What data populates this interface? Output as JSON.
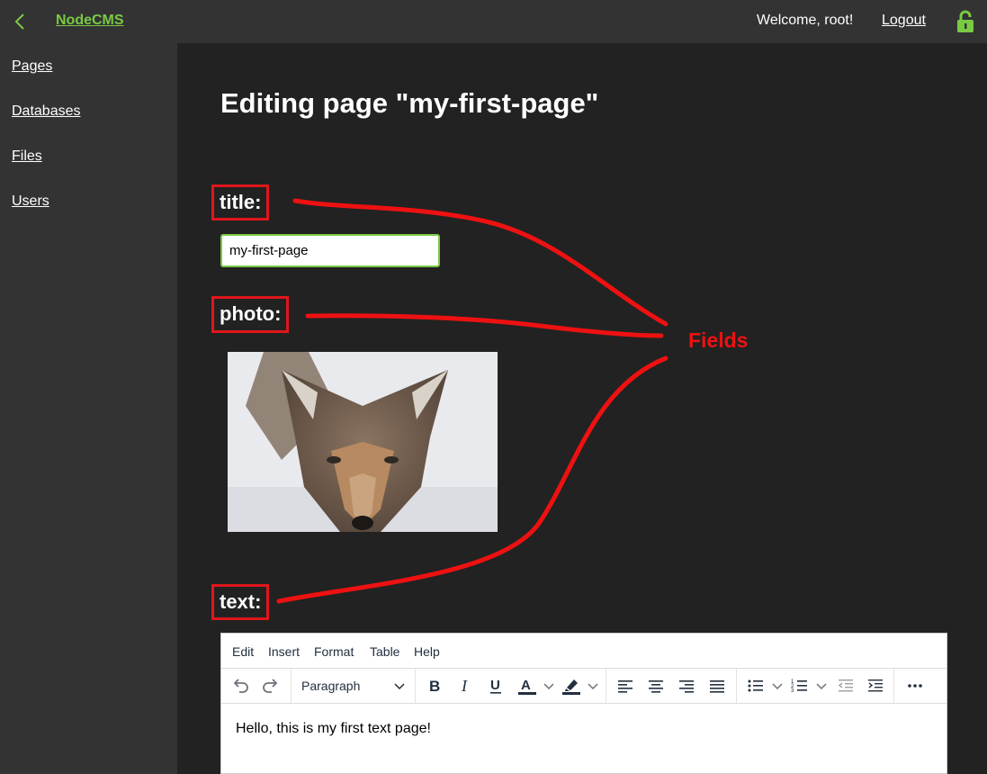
{
  "topbar": {
    "brand": "NodeCMS",
    "welcome": "Welcome, root!",
    "logout": "Logout",
    "back_icon": "chevron-left-icon",
    "lock_icon": "lock-open-icon",
    "accent_color": "#7ac943"
  },
  "sidebar": {
    "items": [
      {
        "label": "Pages"
      },
      {
        "label": "Databases"
      },
      {
        "label": "Files"
      },
      {
        "label": "Users"
      }
    ]
  },
  "main": {
    "heading": "Editing page \"my-first-page\"",
    "fields": {
      "title_label": "title:",
      "title_value": "my-first-page",
      "photo_label": "photo:",
      "text_label": "text:"
    }
  },
  "annotation": {
    "label": "Fields",
    "color": "#ee1111"
  },
  "editor": {
    "menu": [
      "Edit",
      "Insert",
      "Format",
      "Table",
      "Help"
    ],
    "block_format": "Paragraph",
    "content": "Hello, this is my first text page!"
  }
}
